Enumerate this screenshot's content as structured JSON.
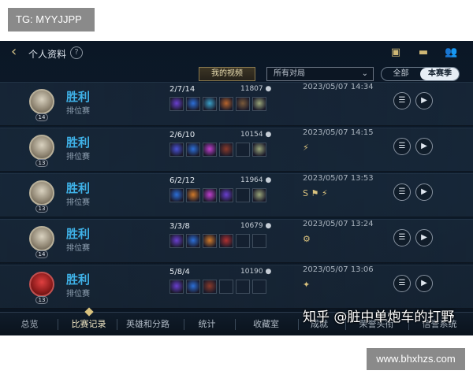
{
  "overlay": {
    "tg_label": "TG: MYYJJPP",
    "site_label": "www.bhxhzs.com"
  },
  "header": {
    "title": "个人资料",
    "help": "?"
  },
  "filters": {
    "my_videos": "我的视频",
    "match_filter": "所有对局",
    "season_tabs": [
      "全部",
      "本赛季"
    ],
    "active_season": "本赛季"
  },
  "matches": [
    {
      "result": "胜利",
      "mode": "排位赛",
      "level": "14",
      "kda": "2/7/14",
      "gold": "11807",
      "time": "2023/05/07 14:34",
      "tags": "",
      "items": [
        "#6a3fd0",
        "#2c6fd8",
        "#3aa0c8",
        "#b6642c",
        "#7a5a3a",
        "#9aa67a"
      ]
    },
    {
      "result": "胜利",
      "mode": "排位赛",
      "level": "13",
      "kda": "2/6/10",
      "gold": "10154",
      "time": "2023/05/07 14:15",
      "tags": "⚡",
      "items": [
        "#4a52d8",
        "#2c6fd8",
        "#c040d0",
        "#8a3a2a",
        "",
        "#9aa67a"
      ]
    },
    {
      "result": "胜利",
      "mode": "排位赛",
      "level": "13",
      "kda": "6/2/12",
      "gold": "11964",
      "time": "2023/05/07 13:53",
      "tags": "S ⚑ ⚡",
      "items": [
        "#2c6fd8",
        "#d07a2a",
        "#c040d0",
        "#6a3fd0",
        "",
        "#9aa67a"
      ]
    },
    {
      "result": "胜利",
      "mode": "排位赛",
      "level": "14",
      "kda": "3/3/8",
      "gold": "10679",
      "time": "2023/05/07 13:24",
      "tags": "⚙",
      "items": [
        "#6a3fd0",
        "#2c6fd8",
        "#d07a2a",
        "#b03030",
        "",
        ""
      ]
    },
    {
      "result": "胜利",
      "mode": "排位赛",
      "level": "13",
      "kda": "5/8/4",
      "gold": "10190",
      "time": "2023/05/07 13:06",
      "tags": "✦",
      "items": [
        "#6a3fd0",
        "#2c6fd8",
        "#8a3a2a",
        "",
        "",
        ""
      ]
    }
  ],
  "bottom_tabs": [
    "总览",
    "比赛记录",
    "英雄和分路",
    "统计",
    "收藏室",
    "成就",
    "荣誉头衔",
    "信誉系统"
  ],
  "active_tab": "比赛记录",
  "watermark": "知乎 @脏中单炮车的打野",
  "icons": {
    "back": "chevron-left-icon",
    "list": "list-icon",
    "replay": "play-icon"
  },
  "colors": {
    "win": "#3fb2e8",
    "accent_gold": "#d9c27e"
  }
}
